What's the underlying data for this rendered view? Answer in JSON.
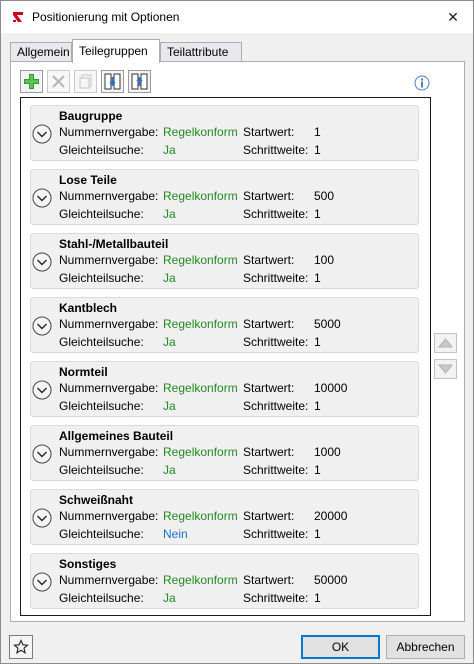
{
  "window": {
    "title": "Positionierung mit Optionen",
    "close_symbol": "✕"
  },
  "tabs": [
    {
      "label": "Allgemein",
      "active": false
    },
    {
      "label": "Teilegruppen",
      "active": true
    },
    {
      "label": "Teilattribute",
      "active": false
    }
  ],
  "toolbar": {
    "buttons": [
      {
        "icon": "add-icon",
        "enabled": true
      },
      {
        "icon": "delete-icon",
        "enabled": false
      },
      {
        "icon": "copy-icon",
        "enabled": false
      },
      {
        "icon": "import-icon",
        "enabled": true
      },
      {
        "icon": "export-icon",
        "enabled": true
      }
    ],
    "info_icon": "info-icon"
  },
  "labels": {
    "nummernvergabe": "Nummernvergabe:",
    "startwert": "Startwert:",
    "gleichteilsuche": "Gleichteilsuche:",
    "schrittweite": "Schrittweite:"
  },
  "groups": [
    {
      "name": "Baugruppe",
      "nummernvergabe": "Regelkonform",
      "startwert": "1",
      "gleichteilsuche": "Ja",
      "schrittweite": "1"
    },
    {
      "name": "Lose Teile",
      "nummernvergabe": "Regelkonform",
      "startwert": "500",
      "gleichteilsuche": "Ja",
      "schrittweite": "1"
    },
    {
      "name": "Stahl-/Metallbauteil",
      "nummernvergabe": "Regelkonform",
      "startwert": "100",
      "gleichteilsuche": "Ja",
      "schrittweite": "1"
    },
    {
      "name": "Kantblech",
      "nummernvergabe": "Regelkonform",
      "startwert": "5000",
      "gleichteilsuche": "Ja",
      "schrittweite": "1"
    },
    {
      "name": "Normteil",
      "nummernvergabe": "Regelkonform",
      "startwert": "10000",
      "gleichteilsuche": "Ja",
      "schrittweite": "1"
    },
    {
      "name": "Allgemeines Bauteil",
      "nummernvergabe": "Regelkonform",
      "startwert": "1000",
      "gleichteilsuche": "Ja",
      "schrittweite": "1"
    },
    {
      "name": "Schweißnaht",
      "nummernvergabe": "Regelkonform",
      "startwert": "20000",
      "gleichteilsuche": "Nein",
      "schrittweite": "1"
    },
    {
      "name": "Sonstiges",
      "nummernvergabe": "Regelkonform",
      "startwert": "50000",
      "gleichteilsuche": "Ja",
      "schrittweite": "1"
    }
  ],
  "colors": {
    "value_green": "#228b22",
    "value_blue": "#1e6fd0",
    "add_green": "#2e9d2e"
  },
  "footer": {
    "ok_label": "OK",
    "cancel_label": "Abbrechen"
  }
}
